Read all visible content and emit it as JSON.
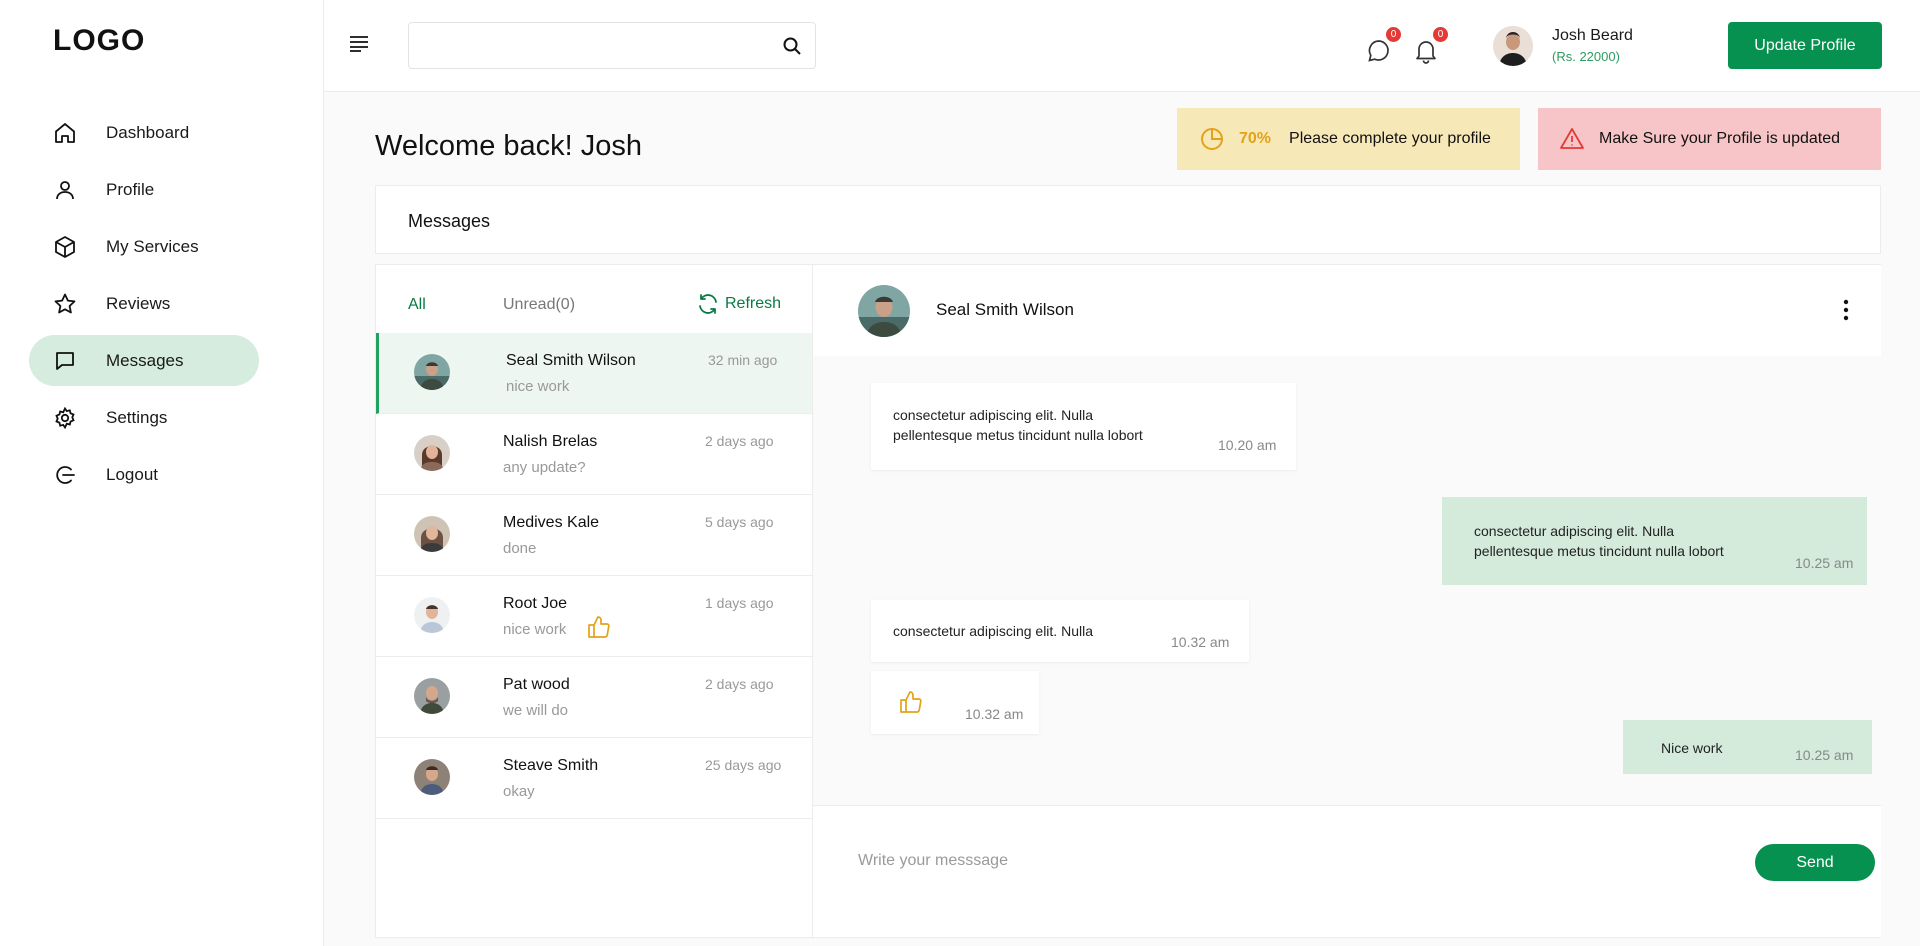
{
  "brand": {
    "logo": "LOGO"
  },
  "sidebar": {
    "items": [
      {
        "label": "Dashboard",
        "icon": "home-icon"
      },
      {
        "label": "Profile",
        "icon": "user-icon"
      },
      {
        "label": "My Services",
        "icon": "box-icon"
      },
      {
        "label": "Reviews",
        "icon": "star-icon"
      },
      {
        "label": "Messages",
        "icon": "chat-icon",
        "active": true
      },
      {
        "label": "Settings",
        "icon": "gear-icon"
      },
      {
        "label": "Logout",
        "icon": "logout-icon"
      }
    ]
  },
  "topbar": {
    "search": {
      "placeholder": "",
      "value": ""
    },
    "messages_badge": "0",
    "notifications_badge": "0",
    "user": {
      "name": "Josh Beard",
      "balance": "(Rs. 22000)"
    },
    "update_profile_label": "Update Profile"
  },
  "welcome": "Welcome back! Josh",
  "alerts": {
    "progress": {
      "percent": "70%",
      "text": "Please complete your profile",
      "color": "#e3a21a"
    },
    "warning": {
      "text": "Make Sure your Profile is updated",
      "color": "#e53935"
    }
  },
  "messages": {
    "title": "Messages",
    "tabs": {
      "all": "All",
      "unread": "Unread(0)",
      "refresh": "Refresh"
    },
    "conversations": [
      {
        "name": "Seal Smith Wilson",
        "preview": "nice work",
        "time": "32 min ago",
        "active": true
      },
      {
        "name": "Nalish Brelas",
        "preview": "any update?",
        "time": "2 days ago"
      },
      {
        "name": "Medives Kale",
        "preview": "done",
        "time": "5 days ago"
      },
      {
        "name": "Root Joe",
        "preview": "nice work",
        "time": "1 days ago",
        "thumb": true
      },
      {
        "name": "Pat wood",
        "preview": "we will do",
        "time": "2 days ago"
      },
      {
        "name": "Steave Smith",
        "preview": "okay",
        "time": "25 days ago"
      }
    ]
  },
  "chat": {
    "contact": "Seal Smith Wilson",
    "bubbles": [
      {
        "dir": "in",
        "line1": "consectetur adipiscing elit. Nulla",
        "line2": "pellentesque metus tincidunt nulla lobort",
        "time": "10.20 am"
      },
      {
        "dir": "out",
        "line1": "consectetur adipiscing elit. Nulla",
        "line2": "pellentesque metus tincidunt nulla lobort",
        "time": "10.25 am"
      },
      {
        "dir": "in",
        "line1": "consectetur adipiscing elit. Nulla",
        "time": "10.32 am"
      },
      {
        "dir": "in",
        "thumb": true,
        "time": "10.32 am"
      },
      {
        "dir": "out",
        "line1": "Nice work",
        "time": "10.25 am"
      }
    ],
    "composer": {
      "placeholder": "Write your messsage",
      "send_label": "Send"
    }
  },
  "colors": {
    "accent": "#079150",
    "active_nav": "#d5ecdf",
    "out_bubble": "#d4eadb",
    "badge": "#e53935"
  }
}
